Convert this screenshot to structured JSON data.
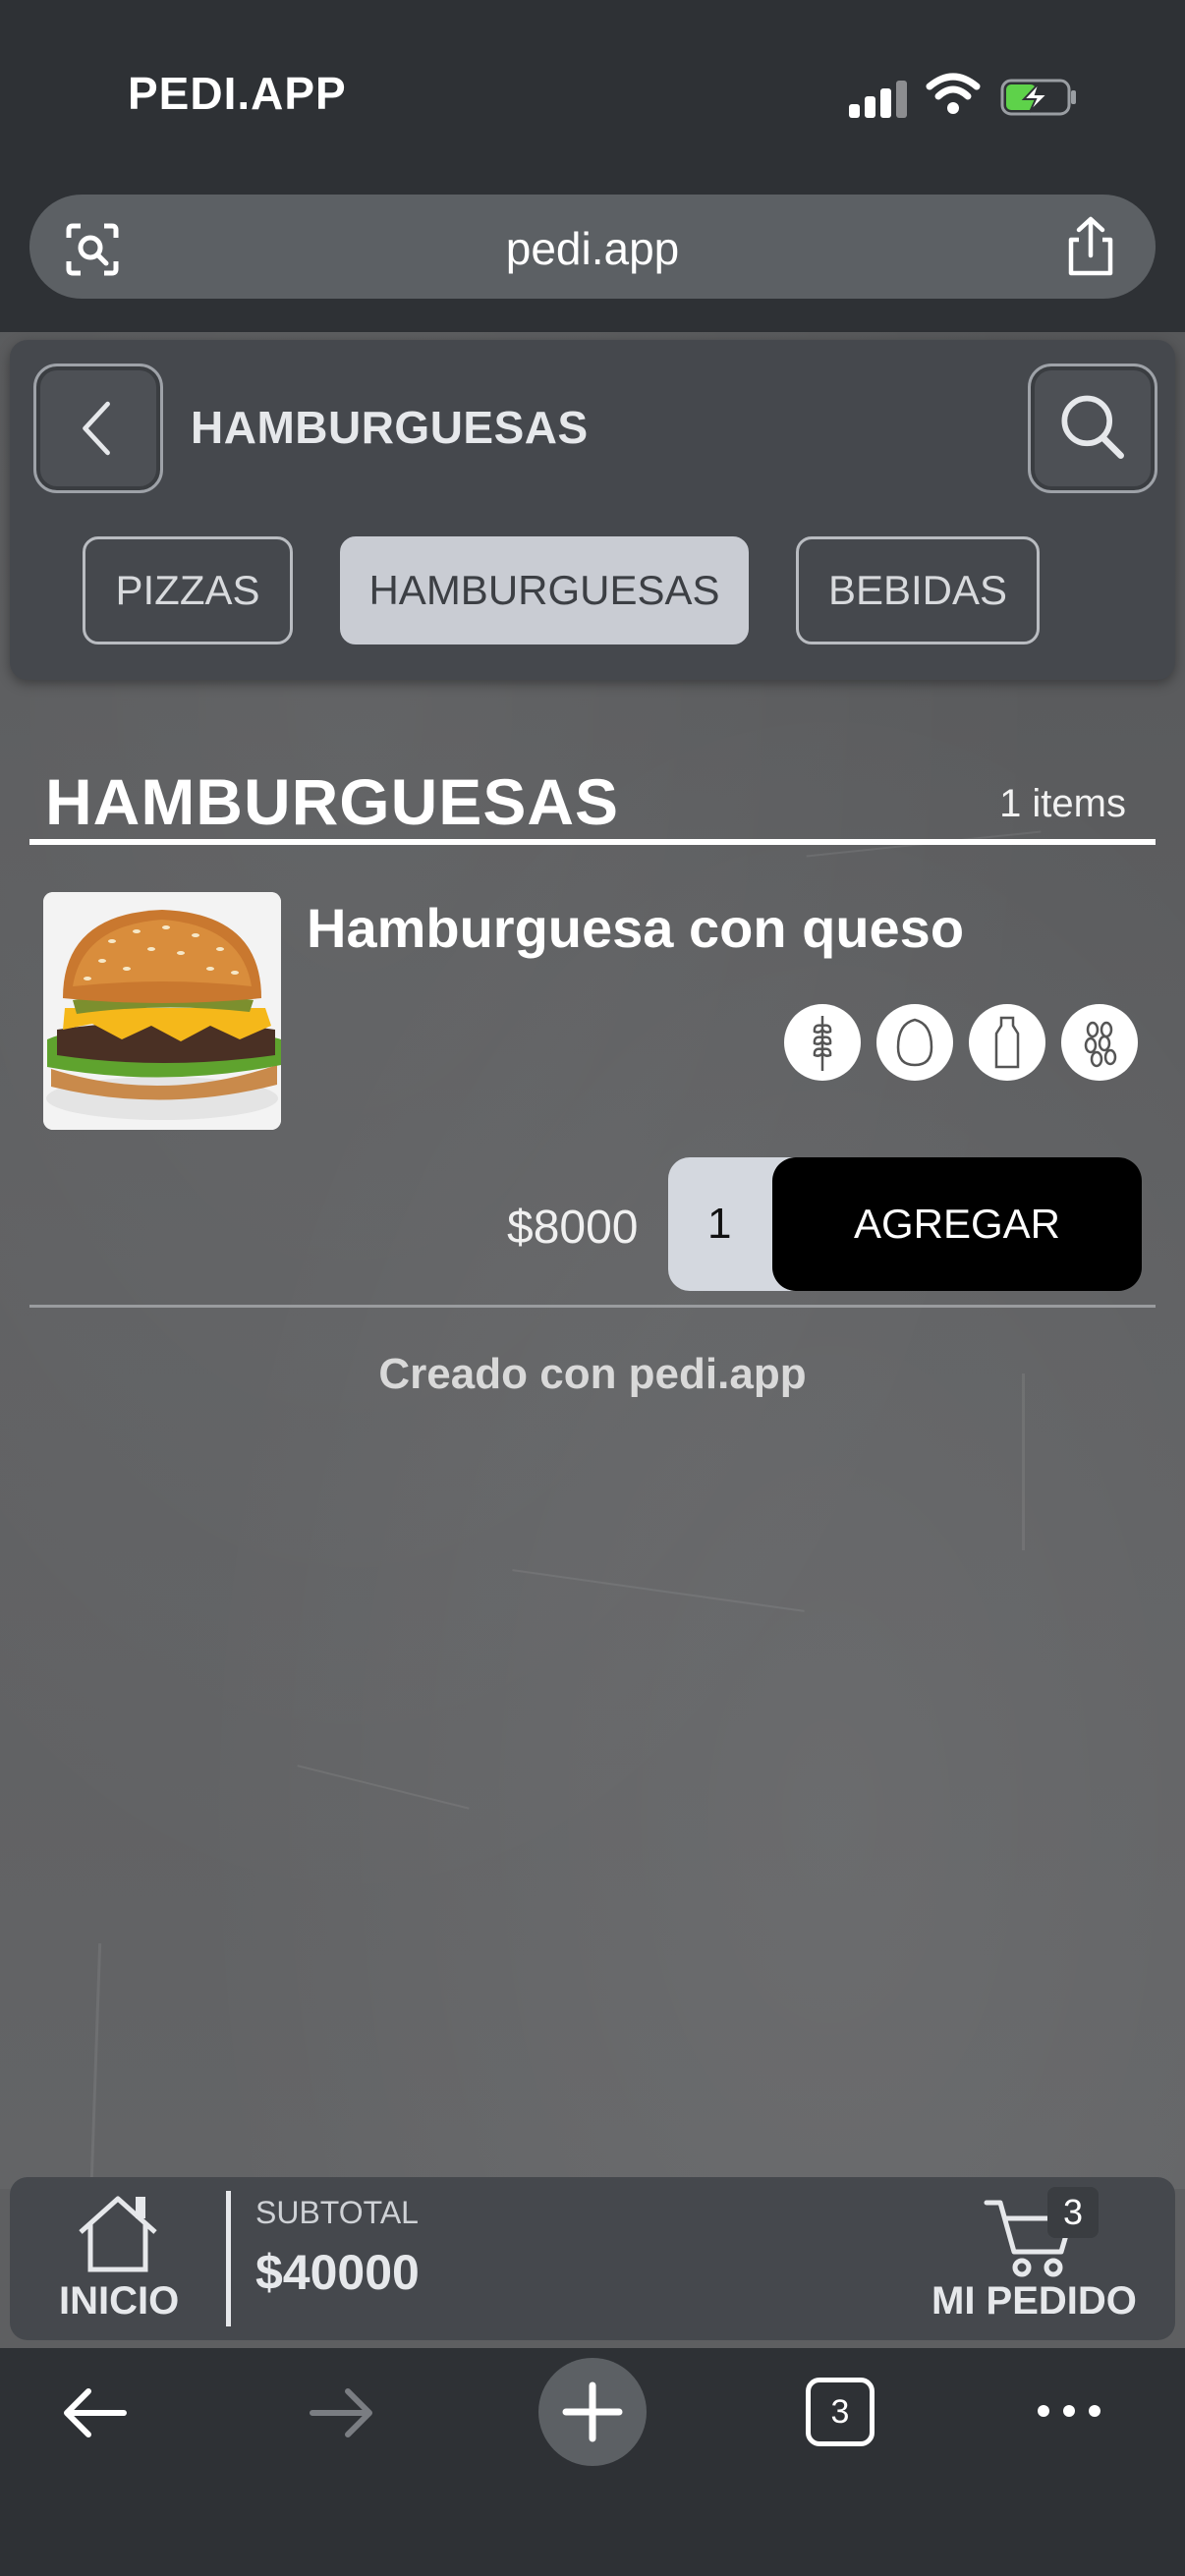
{
  "status_bar": {
    "carrier": "PEDI.APP"
  },
  "browser": {
    "url": "pedi.app",
    "tab_count": "3"
  },
  "header": {
    "title": "HAMBURGUESAS",
    "categories": [
      {
        "label": "PIZZAS",
        "active": false
      },
      {
        "label": "HAMBURGUESAS",
        "active": true
      },
      {
        "label": "BEBIDAS",
        "active": false
      }
    ]
  },
  "section": {
    "title": "HAMBURGUESAS",
    "count": "1 items"
  },
  "product": {
    "name": "Hamburguesa con queso",
    "price": "$8000",
    "quantity": "1",
    "add_label": "AGREGAR",
    "allergens": [
      "wheat-icon",
      "egg-icon",
      "milk-bottle-icon",
      "seeds-icon"
    ]
  },
  "footer_credit": "Creado con pedi.app",
  "bottom_bar": {
    "home_label": "INICIO",
    "subtotal_label": "SUBTOTAL",
    "subtotal_value": "$40000",
    "cart_label": "MI PEDIDO",
    "cart_count": "3"
  },
  "colors": {
    "panel": "#45484d",
    "active_tab": "#c9ccd3",
    "add_button": "#000000",
    "battery_charging": "#5ed24a"
  }
}
